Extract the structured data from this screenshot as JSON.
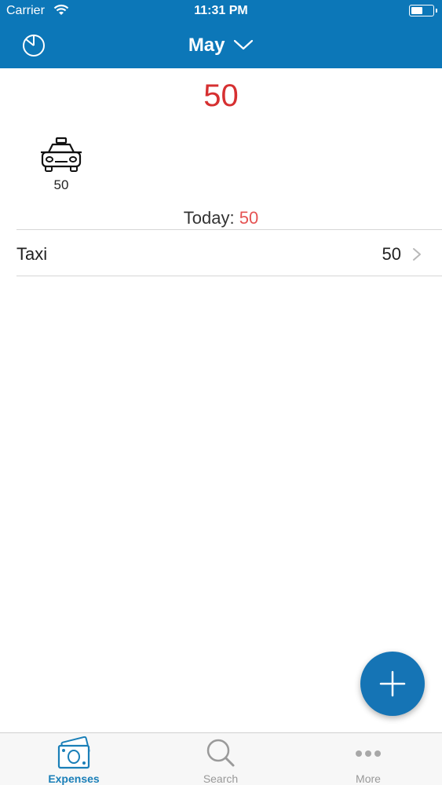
{
  "status_bar": {
    "carrier": "Carrier",
    "time": "11:31 PM"
  },
  "nav": {
    "month": "May"
  },
  "summary": {
    "total": "50",
    "categories": [
      {
        "icon": "taxi-icon",
        "value": "50"
      }
    ],
    "today_label": "Today:",
    "today_amount": "50"
  },
  "expenses": [
    {
      "name": "Taxi",
      "amount": "50"
    }
  ],
  "tabs": [
    {
      "label": "Expenses",
      "icon": "money-icon",
      "active": true
    },
    {
      "label": "Search",
      "icon": "search-icon",
      "active": false
    },
    {
      "label": "More",
      "icon": "more-icon",
      "active": false
    }
  ],
  "colors": {
    "header": "#0c77b8",
    "total_red": "#d63031",
    "today_red": "#e55353",
    "accent": "#1a7fb8",
    "fab": "#1574b5"
  }
}
